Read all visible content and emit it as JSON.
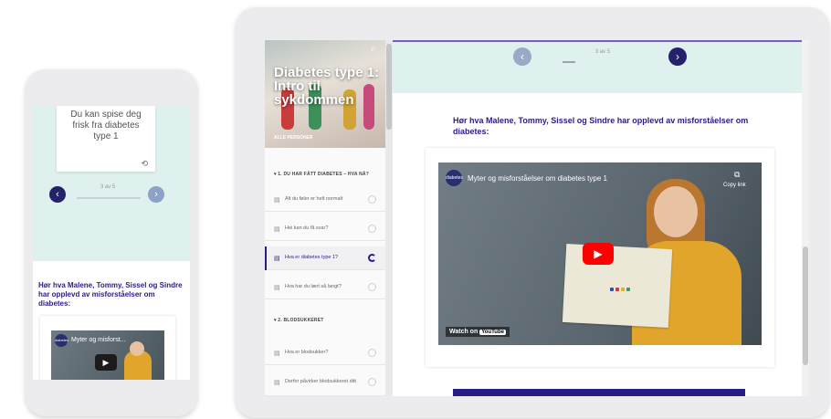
{
  "course": {
    "title": "Diabetes type 1: Intro til sykdommen",
    "hero_label": "ALLE PERSONER"
  },
  "sidebar": {
    "sections": [
      {
        "label": "▾ 1. DU HAR FÅTT DIABETES – HVA NÅ?",
        "items": [
          {
            "label": "Alt du føler er helt normalt",
            "active": false
          },
          {
            "label": "Hei kan du få svar?",
            "active": false
          },
          {
            "label": "Hva er diabetes type 1?",
            "active": true
          },
          {
            "label": "Hva har du lært så langt?",
            "active": false
          }
        ]
      },
      {
        "label": "▾ 2. BLODSUKKERET",
        "items": [
          {
            "label": "Hva er blodsukker?",
            "active": false
          },
          {
            "label": "Derfor påvirker blodsukkeret ditt",
            "active": false
          }
        ]
      }
    ]
  },
  "carousel": {
    "pager_tablet": "3 av 5",
    "pager_phone": "3 av 5",
    "card_text": "Du kan spise deg frisk fra diabetes type 1"
  },
  "content": {
    "heading": "Hør hva Malene, Tommy, Sissel og Sindre har opplevd av misforståelser om diabetes:"
  },
  "video": {
    "title": "Myter og misforståelser om diabetes type 1",
    "phone_title": "Myter og misforst...",
    "logo_text": "diabetes",
    "copy_label": "Copy link",
    "watch_on": "Watch on",
    "youtube": "YouTube"
  },
  "icons": {
    "search": "search-icon",
    "prev": "chevron-left-icon",
    "next": "chevron-right-icon",
    "play": "play-icon",
    "copy": "copy-icon",
    "flip": "flip-icon"
  },
  "colors": {
    "brand_dark": "#2a1c87",
    "teal_bg": "#dff1ef",
    "nav_dark": "#25216b",
    "nav_light": "#9aaac6",
    "youtube_red": "#ff0000",
    "hoodie": "#e2a52b"
  }
}
